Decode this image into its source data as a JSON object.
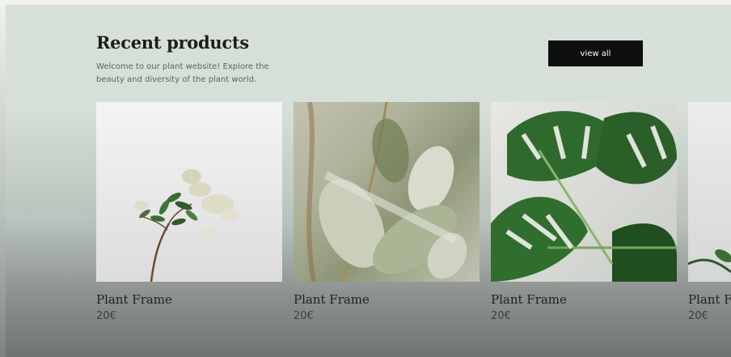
{
  "section": {
    "title": "Recent products",
    "subtitle": "Welcome to our plant website! Explore the beauty and diversity of the plant world.",
    "view_all_label": "view all"
  },
  "products": [
    {
      "name": "Plant Frame",
      "price": "20€",
      "image": "plant-sprig-photo"
    },
    {
      "name": "Plant Frame",
      "price": "20€",
      "image": "soft-leaves-photo"
    },
    {
      "name": "Plant Frame",
      "price": "20€",
      "image": "monstera-leaves-photo"
    },
    {
      "name": "Plant Frame",
      "price": "20€",
      "image": "plant-photo-partial"
    }
  ],
  "colors": {
    "background": "#d7e1d9",
    "button": "#0e0f0f",
    "title": "#1b1f1c"
  }
}
